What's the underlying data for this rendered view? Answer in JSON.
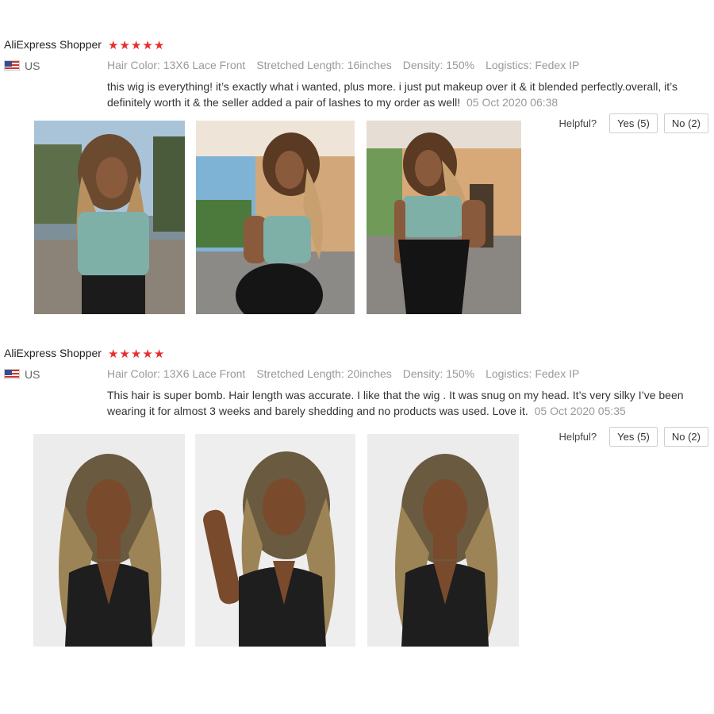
{
  "reviews": [
    {
      "reviewer": "AliExpress Shopper",
      "rating": 5,
      "country": "US",
      "attributes": [
        {
          "key": "Hair Color:",
          "value": "13X6 Lace Front"
        },
        {
          "key": "Stretched Length:",
          "value": "16inches"
        },
        {
          "key": "Density:",
          "value": "150%"
        },
        {
          "key": "Logistics:",
          "value": "Fedex IP"
        }
      ],
      "comment": "this wig is everything! it’s exactly what i wanted, plus more. i just put makeup over it & it blended perfectly.overall, it’s definitely worth it & the seller added a pair of lashes to my order as well!",
      "date": "05 Oct 2020 06:38",
      "helpful_label": "Helpful?",
      "yes_label": "Yes (5)",
      "no_label": "No (2)",
      "photos": [
        "customer-photo-1",
        "customer-photo-2",
        "customer-photo-3"
      ]
    },
    {
      "reviewer": "AliExpress Shopper",
      "rating": 5,
      "country": "US",
      "attributes": [
        {
          "key": "Hair Color:",
          "value": "13X6 Lace Front"
        },
        {
          "key": "Stretched Length:",
          "value": "20inches"
        },
        {
          "key": "Density:",
          "value": "150%"
        },
        {
          "key": "Logistics:",
          "value": "Fedex IP"
        }
      ],
      "comment": "This hair is super bomb. Hair length was accurate. I like that the wig . It was snug on my head. It’s very silky I’ve been wearing it for almost 3 weeks and barely shedding and no products was used. Love it.",
      "date": "05 Oct 2020 05:35",
      "helpful_label": "Helpful?",
      "yes_label": "Yes (5)",
      "no_label": "No (2)",
      "photos": [
        "customer-photo-1",
        "customer-photo-2",
        "customer-photo-3"
      ]
    }
  ],
  "colors": {
    "star": "#e62e2e",
    "muted_text": "#999999"
  },
  "icons": {
    "star": "star-icon",
    "flag": "us-flag-icon"
  }
}
